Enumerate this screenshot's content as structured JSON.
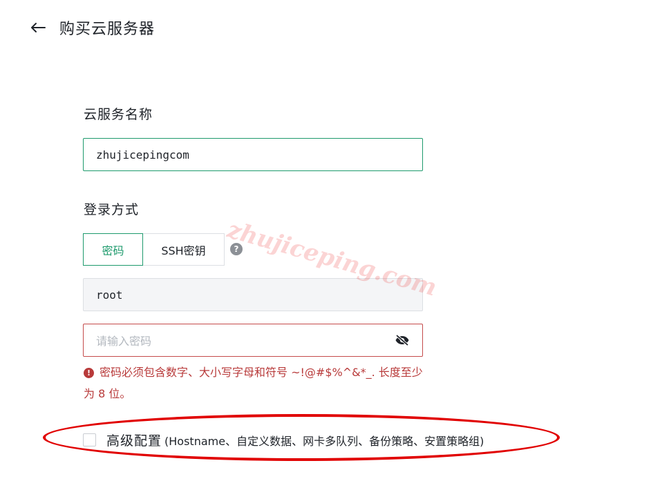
{
  "header": {
    "back_icon": "arrow-left-icon",
    "title": "购买云服务器"
  },
  "form": {
    "name_label": "云服务名称",
    "name_value": "zhujicepingcom",
    "login_label": "登录方式",
    "login_options": [
      "密码",
      "SSH密钥"
    ],
    "login_selected": "密码",
    "help_icon": "question-circle-icon",
    "username_value": "root",
    "password_placeholder": "请输入密码",
    "password_value": "",
    "eye_icon": "eye-off-icon",
    "error_icon": "exclamation-circle-icon",
    "error_text": "密码必须包含数字、大小写字母和符号 ~!@#$%^&*_. 长度至少为 8 位。",
    "advanced_checked": false,
    "advanced_label": "高级配置",
    "advanced_subtext": "(Hostname、自定义数据、网卡多队列、备份策略、安置策略组)"
  },
  "overlay": {
    "watermark": "zhujiceping.com",
    "highlight_color": "#e10000"
  },
  "colors": {
    "accent": "#1d9a6c",
    "error": "#b83a3a",
    "text": "#1f2329"
  }
}
